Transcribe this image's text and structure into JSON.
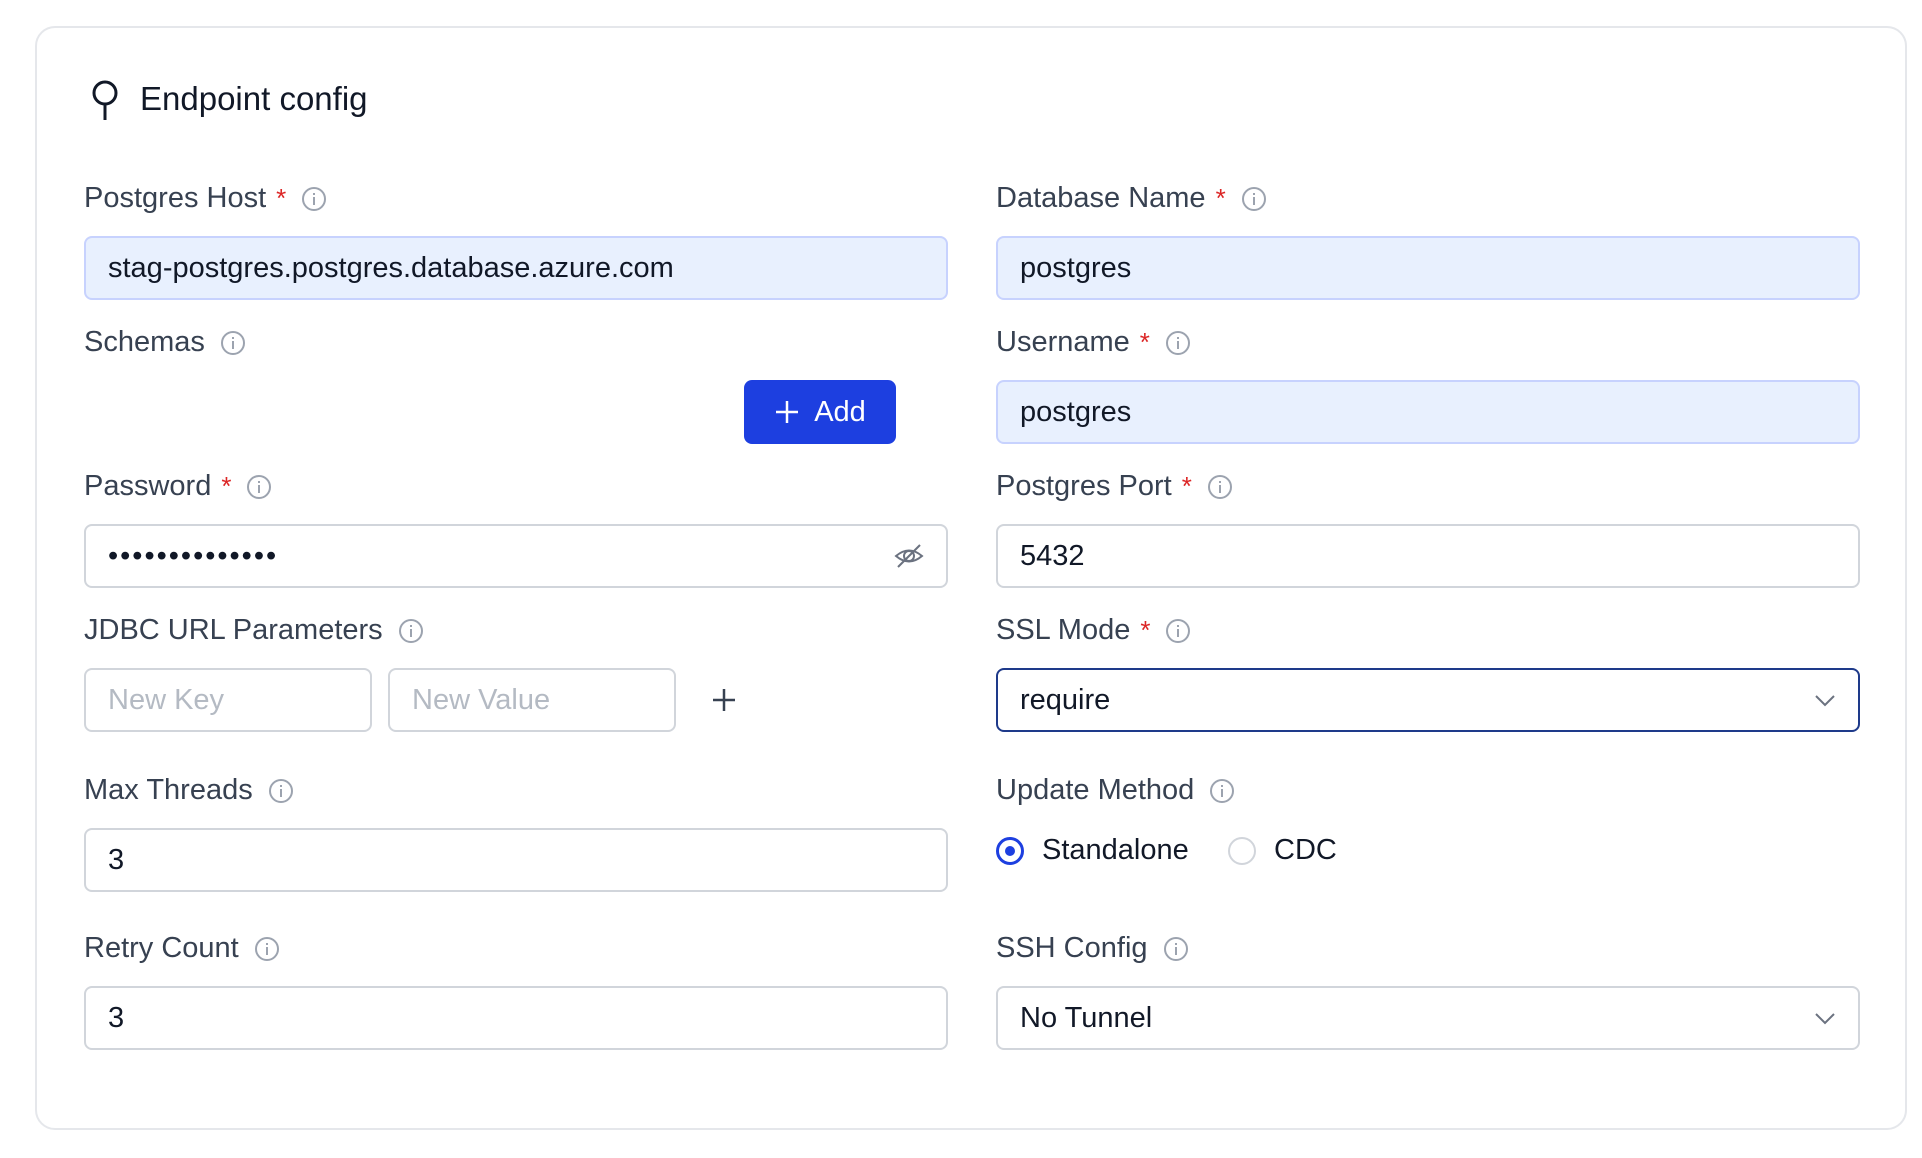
{
  "section": {
    "title": "Endpoint config",
    "icon": "pin-icon"
  },
  "postgres_host": {
    "label": "Postgres Host",
    "required": "*",
    "value": "stag-postgres.postgres.database.azure.com"
  },
  "database_name": {
    "label": "Database Name",
    "required": "*",
    "value": "postgres"
  },
  "schemas": {
    "label": "Schemas",
    "add_label": "Add"
  },
  "username": {
    "label": "Username",
    "required": "*",
    "value": "postgres"
  },
  "password": {
    "label": "Password",
    "required": "*",
    "value": "••••••••••••••",
    "icon": "eye-off-icon"
  },
  "postgres_port": {
    "label": "Postgres Port",
    "required": "*",
    "value": "5432"
  },
  "jdbc": {
    "label": "JDBC URL Parameters",
    "key_placeholder": "New Key",
    "value_placeholder": "New Value"
  },
  "ssl_mode": {
    "label": "SSL Mode",
    "required": "*",
    "value": "require"
  },
  "max_threads": {
    "label": "Max Threads",
    "value": "3"
  },
  "update_method": {
    "label": "Update Method",
    "options": [
      "Standalone",
      "CDC"
    ],
    "selected": "Standalone"
  },
  "retry_count": {
    "label": "Retry Count",
    "value": "3"
  },
  "ssh_config": {
    "label": "SSH Config",
    "value": "No Tunnel"
  },
  "colors": {
    "accent": "#1d3fe0",
    "required": "#dc2626",
    "filled_bg": "#e8f0fe"
  }
}
